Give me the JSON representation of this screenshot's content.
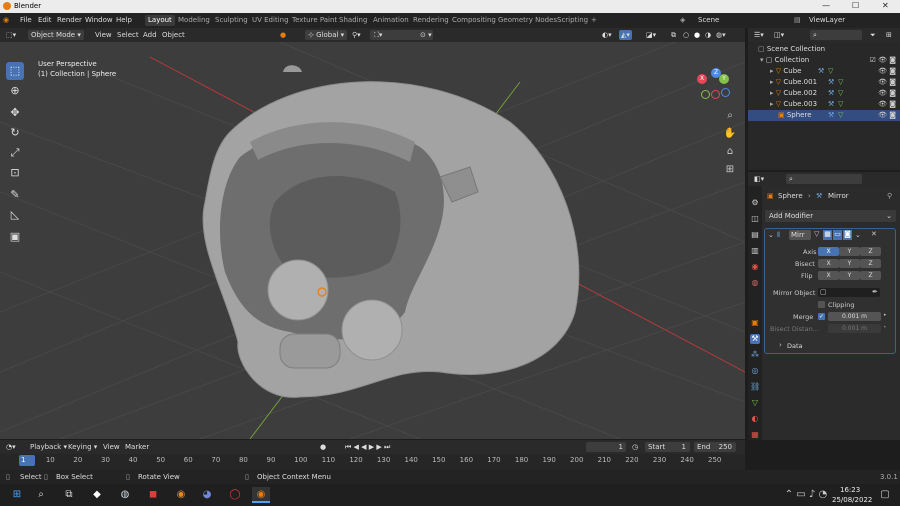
{
  "window": {
    "title": "Blender",
    "minimize": "—",
    "maximize": "☐",
    "close": "✕"
  },
  "menu": {
    "items": [
      "File",
      "Edit",
      "Render",
      "Window",
      "Help"
    ]
  },
  "workspaces": [
    "Layout",
    "Modeling",
    "Sculpting",
    "UV Editing",
    "Texture Paint",
    "Shading",
    "Animation",
    "Rendering",
    "Compositing",
    "Geometry Nodes",
    "Scripting",
    "+"
  ],
  "scene": {
    "label": "Scene",
    "view_layer": "ViewLayer"
  },
  "viewport_header": {
    "mode": "Object Mode",
    "view": "View",
    "select": "Select",
    "add": "Add",
    "object": "Object",
    "orientation": "Global",
    "options": "Options"
  },
  "viewport": {
    "perspective": "User Perspective",
    "collection_label": "(1) Collection | Sphere"
  },
  "gizmo": {
    "x": "X",
    "y": "Y",
    "z": "Z"
  },
  "outliner": {
    "scene_collection": "Scene Collection",
    "collection": "Collection",
    "objects": [
      "Cube",
      "Cube.001",
      "Cube.002",
      "Cube.003",
      "Sphere"
    ]
  },
  "properties": {
    "object_name": "Sphere",
    "modifier_path": "Mirror",
    "add_modifier": "Add Modifier",
    "modifier_name": "Mirr",
    "axis_label": "Axis",
    "bisect_label": "Bisect",
    "flip_label": "Flip",
    "axis_x": "X",
    "axis_y": "Y",
    "axis_z": "Z",
    "mirror_object_label": "Mirror Object",
    "clipping_label": "Clipping",
    "merge_label": "Merge",
    "merge_value": "0.001 m",
    "bisect_distance_label": "Bisect Distan...",
    "bisect_distance_value": "0.001 m",
    "data_label": "Data"
  },
  "timeline": {
    "playback": "Playback",
    "keying": "Keying",
    "view": "View",
    "marker": "Marker",
    "current_frame": "1",
    "start_label": "Start",
    "start_value": "1",
    "end_label": "End",
    "end_value": "250",
    "ticks": [
      "1",
      "10",
      "20",
      "30",
      "40",
      "50",
      "60",
      "70",
      "80",
      "90",
      "100",
      "110",
      "120",
      "130",
      "140",
      "150",
      "160",
      "170",
      "180",
      "190",
      "200",
      "210",
      "220",
      "230",
      "240",
      "250"
    ]
  },
  "statusbar": {
    "select": "Select",
    "box_select": "Box Select",
    "rotate_view": "Rotate View",
    "context_menu": "Object Context Menu",
    "version": "3.0.1"
  },
  "taskbar": {
    "time": "16:23",
    "date": "25/08/2022"
  },
  "colors": {
    "accent": "#4772b3",
    "orange": "#e87d0d",
    "viewport_bg": "#3d3d3d"
  }
}
